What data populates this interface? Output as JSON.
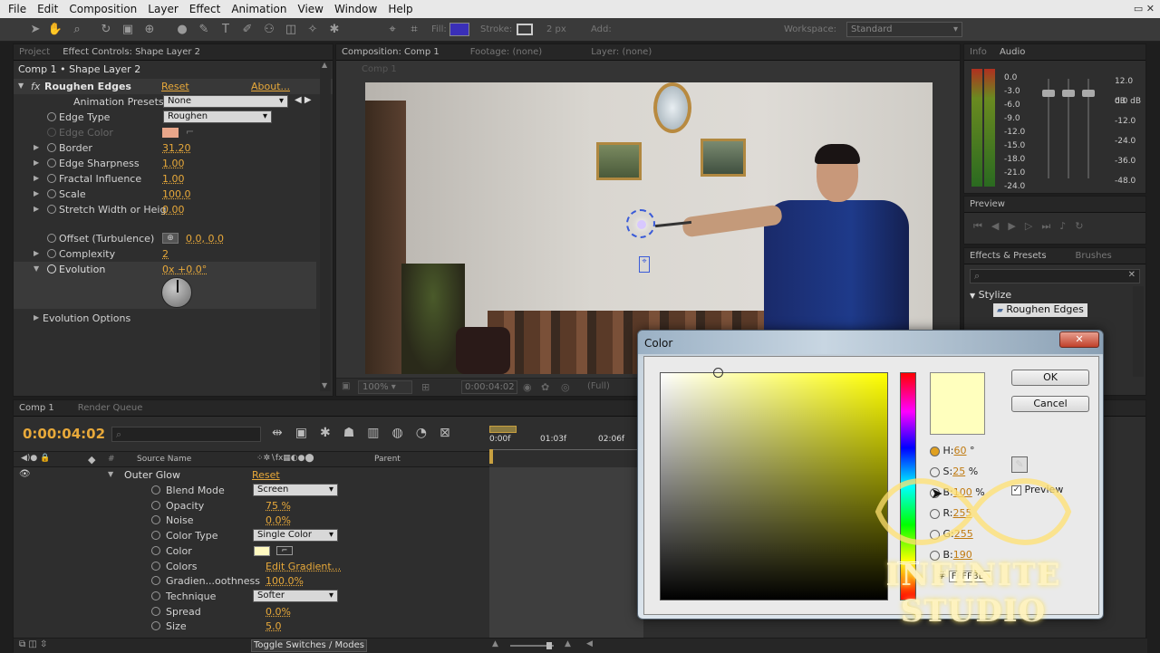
{
  "menu": [
    "File",
    "Edit",
    "Composition",
    "Layer",
    "Effect",
    "Animation",
    "View",
    "Window",
    "Help"
  ],
  "toolbar": {
    "fill_label": "Fill:",
    "stroke_label": "Stroke:",
    "stroke_width": "2 px",
    "add_label": "Add:",
    "workspace_label": "Workspace:",
    "workspace_value": "Standard",
    "fill_color": "#3a2fb8"
  },
  "effect_panel": {
    "tabs": [
      "Project",
      "Effect Controls: Shape Layer 2"
    ],
    "header": "Comp 1 • Shape Layer 2",
    "effect_name": "Roughen Edges",
    "reset": "Reset",
    "about": "About...",
    "presets_label": "Animation Presets:",
    "presets_value": "None",
    "edge_type_label": "Edge Type",
    "edge_type_value": "Roughen",
    "edge_color_label": "Edge Color",
    "edge_color": "#e8a68a",
    "props": [
      {
        "name": "Border",
        "value": "31.20"
      },
      {
        "name": "Edge Sharpness",
        "value": "1.00"
      },
      {
        "name": "Fractal Influence",
        "value": "1.00"
      },
      {
        "name": "Scale",
        "value": "100.0"
      },
      {
        "name": "Stretch Width or Heig",
        "value": "0.00"
      }
    ],
    "offset_label": "Offset (Turbulence)",
    "offset_value": "0.0, 0.0",
    "complexity_label": "Complexity",
    "complexity_value": "2",
    "evolution_label": "Evolution",
    "evolution_value": "0x +0.0°",
    "evolution_options": "Evolution Options"
  },
  "composition": {
    "tabs": [
      "Composition: Comp 1",
      "Footage: (none)",
      "Layer: (none)"
    ],
    "sub_label": "Comp 1",
    "zoom": "100%",
    "timecode": "0:00:04:02",
    "resolution": "(Full)"
  },
  "audio_panel": {
    "tabs": [
      "Info",
      "Audio"
    ],
    "left_scale": [
      "0.0",
      "-3.0",
      "-6.0",
      "-9.0",
      "-12.0",
      "-15.0",
      "-18.0",
      "-21.0",
      "-24.0"
    ],
    "right_scale": [
      "12.0 dB",
      "0.0 dB",
      "-12.0",
      "-24.0",
      "-36.0",
      "-48.0 dB"
    ]
  },
  "preview_panel": {
    "tab": "Preview"
  },
  "effects_presets": {
    "tabs": [
      "Effects & Presets",
      "Brushes"
    ],
    "category": "Stylize",
    "item": "Roughen Edges"
  },
  "timeline": {
    "tabs": [
      "Comp 1",
      "Render Queue"
    ],
    "timecode": "0:00:04:02",
    "col_source": "Source Name",
    "col_parent": "Parent",
    "ruler": [
      "0:00f",
      "01:03f",
      "02:06f"
    ],
    "layer_name": "Outer Glow",
    "reset": "Reset",
    "props": [
      {
        "name": "Blend Mode",
        "type": "dropdown",
        "value": "Screen"
      },
      {
        "name": "Opacity",
        "type": "value",
        "value": "75 %"
      },
      {
        "name": "Noise",
        "type": "value",
        "value": "0.0%"
      },
      {
        "name": "Color Type",
        "type": "dropdown",
        "value": "Single Color"
      },
      {
        "name": "Color",
        "type": "color",
        "value": ""
      },
      {
        "name": "Colors",
        "type": "value",
        "value": "Edit Gradient..."
      },
      {
        "name": "Gradien...oothness",
        "type": "value",
        "value": "100.0%"
      },
      {
        "name": "Technique",
        "type": "dropdown",
        "value": "Softer"
      },
      {
        "name": "Spread",
        "type": "value",
        "value": "0.0%"
      },
      {
        "name": "Size",
        "type": "value",
        "value": "5.0"
      }
    ],
    "glow_color": "#fff9c0",
    "toggle_label": "Toggle Switches / Modes"
  },
  "color_dialog": {
    "title": "Color",
    "ok": "OK",
    "cancel": "Cancel",
    "h_label": "H:",
    "h_value": "60",
    "h_unit": "°",
    "s_label": "S:",
    "s_value": "25",
    "s_unit": "%",
    "b_label": "B:",
    "b_value": "100",
    "b_unit": "%",
    "r_label": "R:",
    "r_value": "255",
    "g_label": "G:",
    "g_value": "255",
    "b2_label": "B:",
    "b2_value": "190",
    "hex_label": "#",
    "hex_value": "FFFFBE",
    "preview_label": "Preview",
    "swatch_color": "#ffffbe"
  },
  "watermark": {
    "text": "INFINITE STUDIO"
  }
}
